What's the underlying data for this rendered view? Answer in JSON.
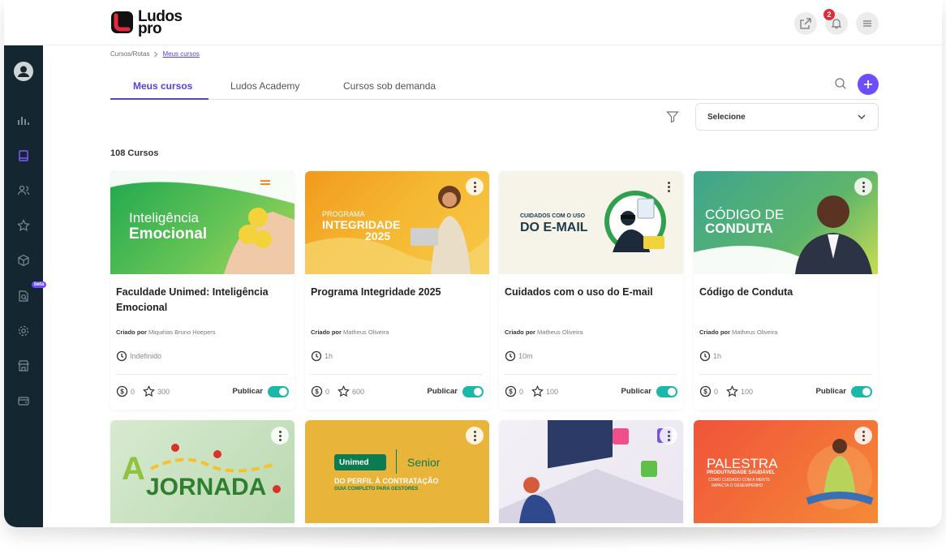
{
  "brand": {
    "name_line1": "Ludos",
    "name_line2": "pro"
  },
  "header": {
    "notifications_count": "2"
  },
  "breadcrumb": {
    "root": "Cursos/Rotas",
    "current": "Meus cursos"
  },
  "tabs": [
    {
      "label": "Meus cursos",
      "active": true
    },
    {
      "label": "Ludos Academy",
      "active": false
    },
    {
      "label": "Cursos sob demanda",
      "active": false
    }
  ],
  "filter": {
    "select_value": "Selecione"
  },
  "sidebar": {
    "beta_label": "beta"
  },
  "course_count": "108 Cursos",
  "labels": {
    "created_by": "Criado por",
    "publish": "Publicar"
  },
  "courses": [
    {
      "title": "Faculdade Unimed: Inteligência Emocional",
      "author": "Miquéias Bruno Hoepers",
      "duration": "Indefinido",
      "price": "0",
      "points": "300",
      "published": true,
      "cover": {
        "line1": "Inteligência",
        "line2": "Emocional",
        "colors": [
          "#1fa84f",
          "#a8d85a"
        ]
      }
    },
    {
      "title": "Programa Integridade 2025",
      "author": "Matheus Oliveira",
      "duration": "1h",
      "price": "0",
      "points": "600",
      "published": true,
      "cover": {
        "line1": "PROGRAMA",
        "line2": "INTEGRIDADE",
        "line3": "2025",
        "colors": [
          "#f29a1e",
          "#f7c94a"
        ]
      }
    },
    {
      "title": "Cuidados com o uso do E-mail",
      "author": "Matheus Oliveira",
      "duration": "10m",
      "price": "0",
      "points": "100",
      "published": true,
      "cover": {
        "line1": "CUIDADOS COM O USO",
        "line2": "DO E-MAIL",
        "colors": [
          "#f6f3e8",
          "#f6f3e8"
        ]
      }
    },
    {
      "title": "Código de Conduta",
      "author": "Matheus Oliveira",
      "duration": "1h",
      "price": "0",
      "points": "100",
      "published": true,
      "cover": {
        "line1": "CÓDIGO DE",
        "line2": "CONDUTA",
        "colors": [
          "#3ea58d",
          "#c9dc52"
        ]
      }
    },
    {
      "cover": {
        "line1": "A",
        "line2": "JORNADA",
        "colors": [
          "#d8ead0",
          "#b9d9b0"
        ]
      }
    },
    {
      "cover": {
        "line1": "Unimed",
        "line2": "Senior",
        "line3": "DO PERFIL À CONTRATAÇÃO",
        "line4": "GUIA COMPLETO PARA GESTORES",
        "colors": [
          "#e8b43a",
          "#e9b83d"
        ]
      }
    },
    {
      "cover": {
        "colors": [
          "#f3f0f6",
          "#ebe6f0"
        ]
      }
    },
    {
      "cover": {
        "line1": "PALESTRA",
        "line2": "PRODUTIVIDADE SAUDÁVEL",
        "line3": "COMO CUIDADO COM A MENTE",
        "line4": "IMPACTA O DESEMPENHO",
        "colors": [
          "#f0533a",
          "#f58a37"
        ]
      }
    }
  ]
}
